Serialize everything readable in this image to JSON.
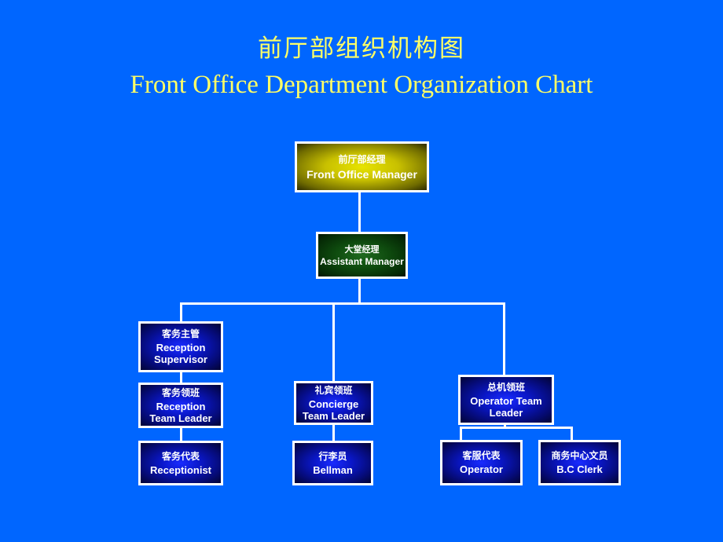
{
  "title": {
    "chinese": "前厅部组织机构图",
    "english": "Front Office Department Organization Chart"
  },
  "colors": {
    "background": "#0066ff",
    "title_text": "#ffff66",
    "node_border": "#ffffff",
    "connector": "#ffffff",
    "manager_fill": "#c8c000",
    "assistant_fill": "#0e4a0e",
    "staff_fill": "#0a17c8"
  },
  "nodes": {
    "front_office_manager": {
      "zh": "前厅部经理",
      "en": "Front Office Manager"
    },
    "assistant_manager": {
      "zh": "大堂经理",
      "en": "Assistant Manager"
    },
    "reception_supervisor": {
      "zh": "客务主管",
      "en": "Reception\nSupervisor"
    },
    "reception_team_leader": {
      "zh": "客务领班",
      "en": "Reception\nTeam Leader"
    },
    "receptionist": {
      "zh": "客务代表",
      "en": "Receptionist"
    },
    "concierge_team_leader": {
      "zh": "礼宾领班",
      "en": "Concierge\nTeam Leader"
    },
    "bellman": {
      "zh": "行李员",
      "en": "Bellman"
    },
    "operator_team_leader": {
      "zh": "总机领班",
      "en": "Operator Team\nLeader"
    },
    "operator": {
      "zh": "客服代表",
      "en": "Operator"
    },
    "bc_clerk": {
      "zh": "商务中心文员",
      "en": "B.C Clerk"
    }
  },
  "hierarchy": [
    {
      "from": "front_office_manager",
      "to": "assistant_manager"
    },
    {
      "from": "assistant_manager",
      "to": "reception_supervisor"
    },
    {
      "from": "assistant_manager",
      "to": "concierge_team_leader"
    },
    {
      "from": "assistant_manager",
      "to": "operator_team_leader"
    },
    {
      "from": "reception_supervisor",
      "to": "reception_team_leader"
    },
    {
      "from": "reception_team_leader",
      "to": "receptionist"
    },
    {
      "from": "concierge_team_leader",
      "to": "bellman"
    },
    {
      "from": "operator_team_leader",
      "to": "operator"
    },
    {
      "from": "operator_team_leader",
      "to": "bc_clerk"
    }
  ]
}
